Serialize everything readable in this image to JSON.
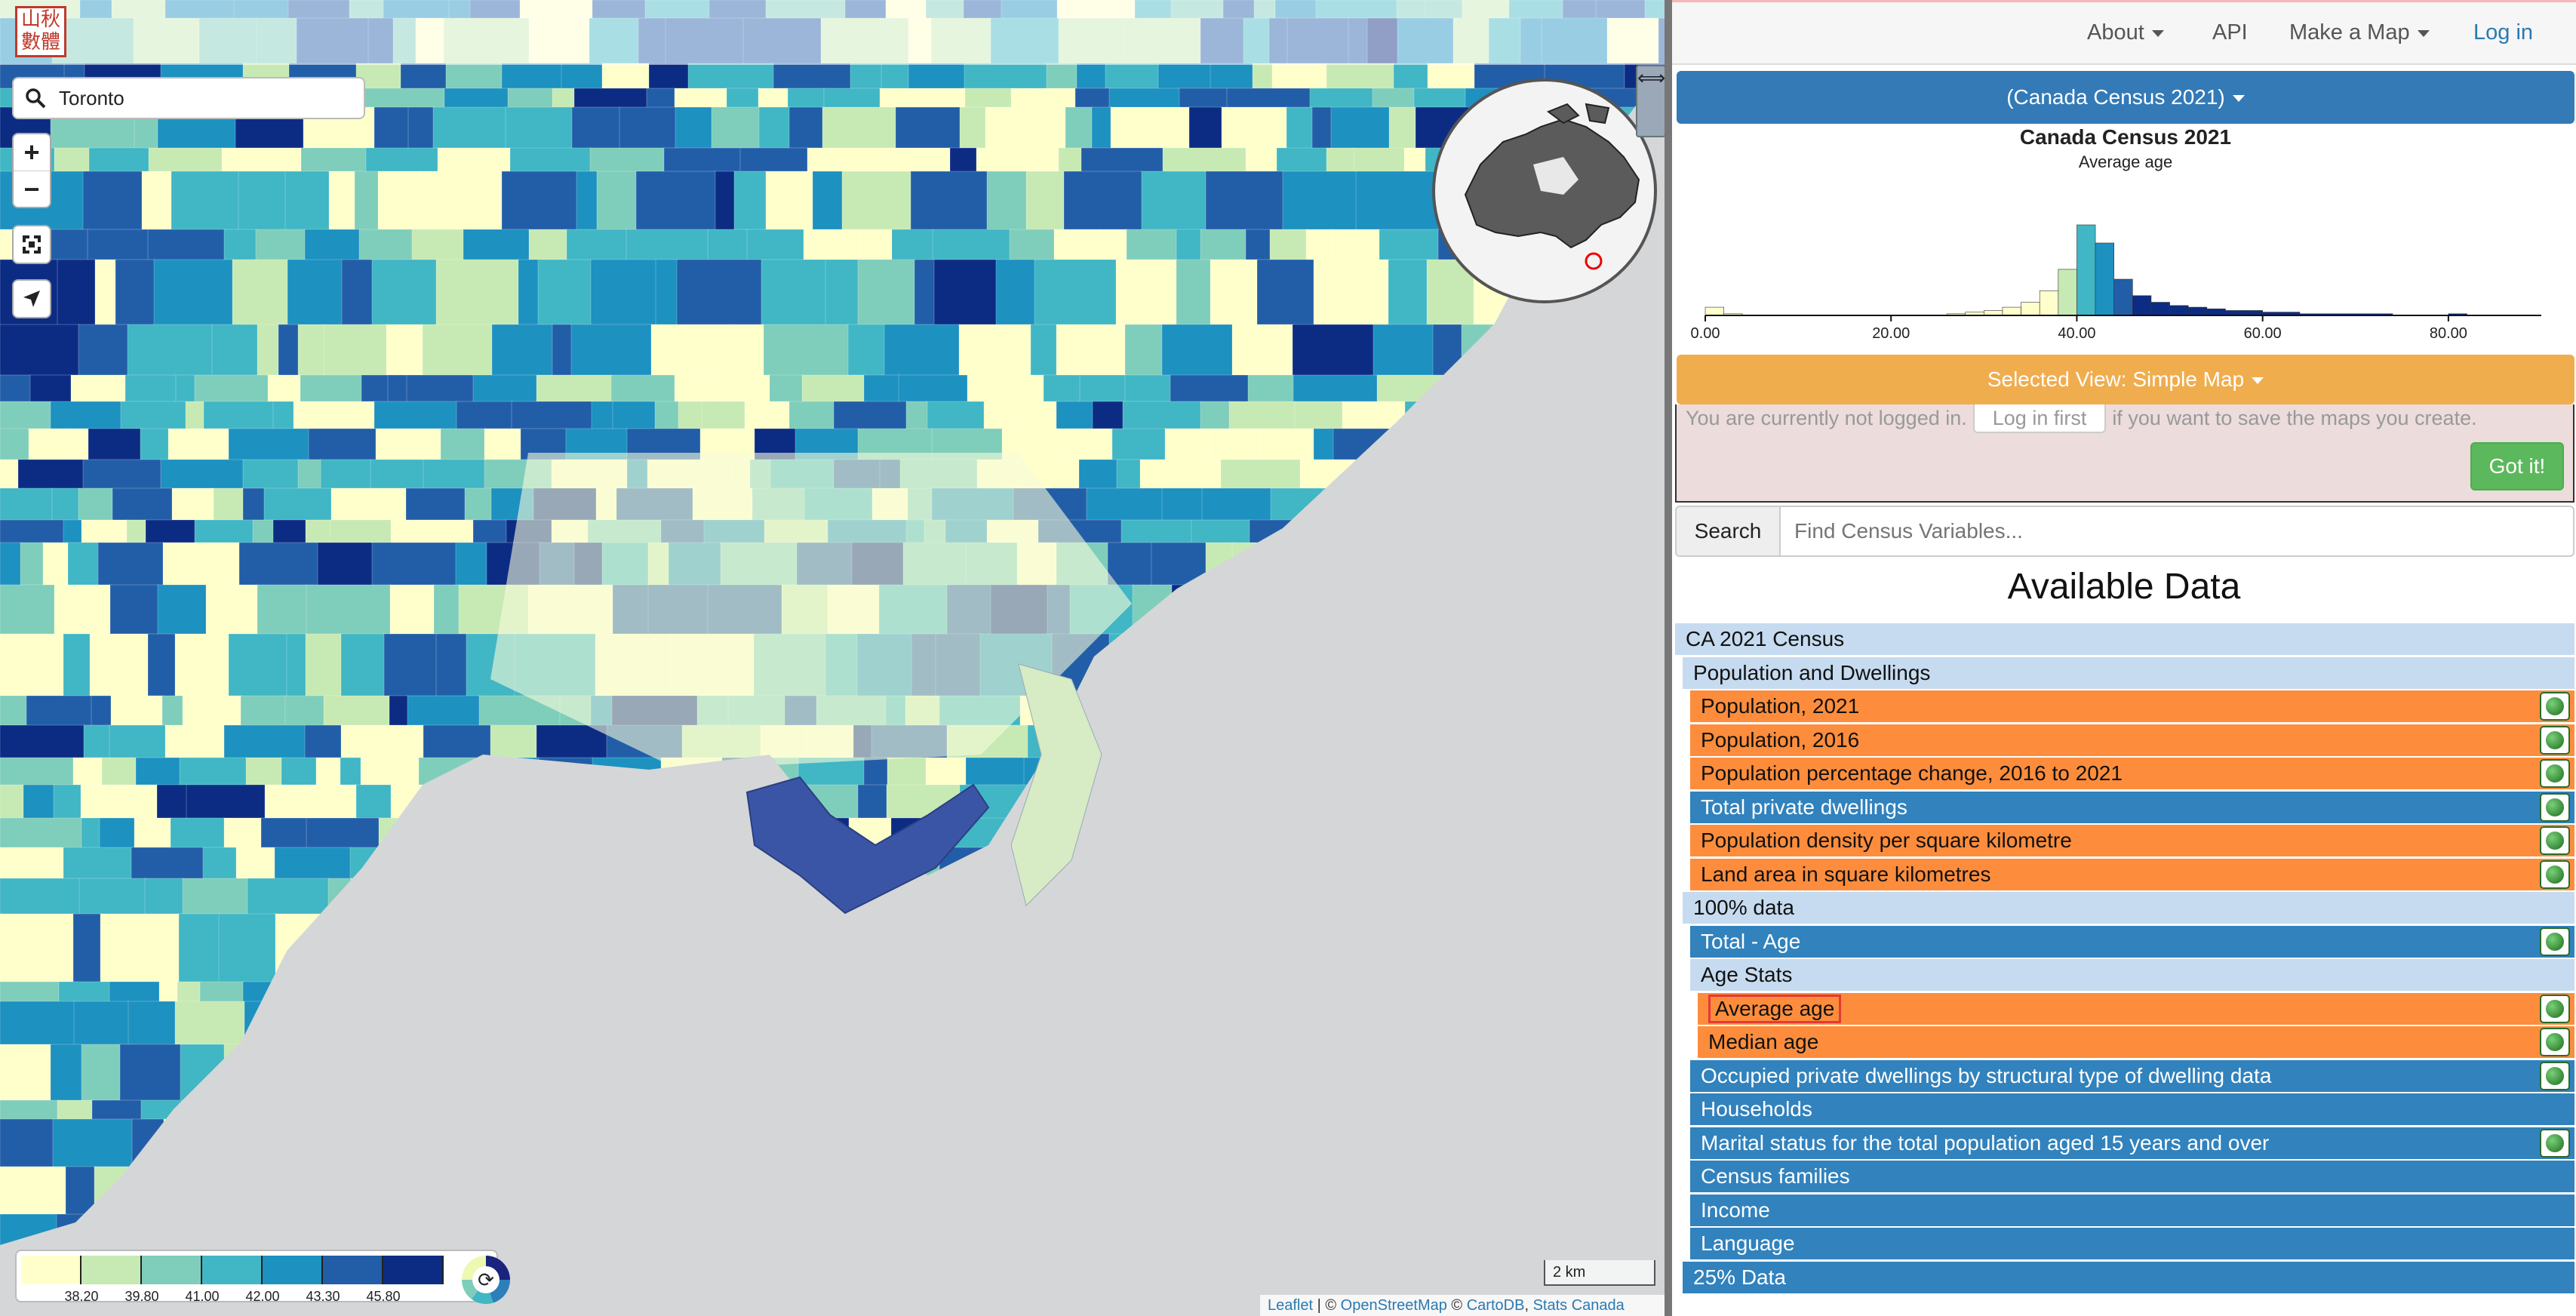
{
  "logo": {
    "text": "山秋數體"
  },
  "map": {
    "search_value": "Toronto",
    "zoom_in": "+",
    "zoom_out": "−",
    "collapse_glyph": "⟺",
    "legend": {
      "colors": [
        "#ffffcc",
        "#c7e9b4",
        "#7fcdbb",
        "#41b6c4",
        "#1d91c0",
        "#225ea8",
        "#0c2c84"
      ],
      "breaks": [
        "38.20",
        "39.80",
        "41.00",
        "42.00",
        "43.30",
        "45.80"
      ]
    },
    "scale": "2 km",
    "attribution": {
      "leaflet": "Leaflet",
      "sep": " | © ",
      "osm": "OpenStreetMap",
      "sep2": " © ",
      "carto": "CartoDB",
      "sep3": ", ",
      "statcan": "Stats Canada"
    }
  },
  "nav": {
    "about": "About",
    "api": "API",
    "make_map": "Make a Map",
    "login": "Log in"
  },
  "panel": {
    "census_select": "(Canada Census 2021)",
    "hist_title": "Canada Census 2021",
    "hist_subtitle": "Average age",
    "view_select": "Selected View: Simple Map",
    "login_msg_before": "You are currently not logged in.",
    "login_btn": "Log in first",
    "login_msg_after": "if you want to save the maps you create.",
    "got_it": "Got it!",
    "search_addon": "Search",
    "search_placeholder": "Find Census Variables...",
    "available_title": "Available Data"
  },
  "chart_data": {
    "type": "bar",
    "title": "Canada Census 2021",
    "subtitle": "Average age",
    "xticks": [
      "0.00",
      "20.00",
      "40.00",
      "60.00",
      "80.00"
    ],
    "xlim": [
      0,
      90
    ],
    "bins": [
      0,
      2,
      4,
      6,
      8,
      10,
      12,
      14,
      16,
      18,
      20,
      22,
      24,
      26,
      28,
      30,
      32,
      34,
      36,
      38,
      40,
      42,
      44,
      46,
      48,
      50,
      52,
      54,
      56,
      58,
      60,
      62,
      64,
      66,
      68,
      70,
      72,
      74,
      76,
      78,
      80,
      82,
      84,
      86,
      88
    ],
    "values": [
      5,
      1,
      0,
      0,
      0,
      0,
      0,
      0,
      0,
      0,
      0,
      0,
      0,
      1,
      2,
      3,
      5,
      8,
      15,
      28,
      55,
      44,
      22,
      12,
      8,
      6,
      5,
      4,
      3,
      3,
      2,
      2,
      1,
      1,
      1,
      1,
      1,
      0,
      0,
      0,
      1,
      0,
      0,
      0,
      0
    ]
  },
  "tree": [
    {
      "label": "CA 2021 Census",
      "type": "lb",
      "indent": 0,
      "globe": false
    },
    {
      "label": "Population and Dwellings",
      "type": "lb",
      "indent": 1,
      "globe": false
    },
    {
      "label": "Population, 2021",
      "type": "or",
      "indent": 2,
      "globe": true
    },
    {
      "label": "Population, 2016",
      "type": "or",
      "indent": 2,
      "globe": true
    },
    {
      "label": "Population percentage change, 2016 to 2021",
      "type": "or",
      "indent": 2,
      "globe": true
    },
    {
      "label": "Total private dwellings",
      "type": "bl",
      "indent": 2,
      "globe": true
    },
    {
      "label": "Population density per square kilometre",
      "type": "or",
      "indent": 2,
      "globe": true
    },
    {
      "label": "Land area in square kilometres",
      "type": "or",
      "indent": 2,
      "globe": true
    },
    {
      "label": "100% data",
      "type": "lb",
      "indent": 1,
      "globe": false
    },
    {
      "label": "Total - Age",
      "type": "bl",
      "indent": 2,
      "globe": true
    },
    {
      "label": "Age Stats",
      "type": "lb",
      "indent": 2,
      "globe": false
    },
    {
      "label": "Average age",
      "type": "or",
      "indent": 3,
      "globe": true,
      "highlight": true
    },
    {
      "label": "Median age",
      "type": "or",
      "indent": 3,
      "globe": true
    },
    {
      "label": "Occupied private dwellings by structural type of dwelling data",
      "type": "bl",
      "indent": 2,
      "globe": true
    },
    {
      "label": "Households",
      "type": "bl",
      "indent": 2,
      "globe": false
    },
    {
      "label": "Marital status for the total population aged 15 years and over",
      "type": "bl",
      "indent": 2,
      "globe": true
    },
    {
      "label": "Census families",
      "type": "bl",
      "indent": 2,
      "globe": false
    },
    {
      "label": "Income",
      "type": "bl",
      "indent": 2,
      "globe": false
    },
    {
      "label": "Language",
      "type": "bl",
      "indent": 2,
      "globe": false
    },
    {
      "label": "25% Data",
      "type": "bl",
      "indent": 1,
      "globe": false
    }
  ]
}
